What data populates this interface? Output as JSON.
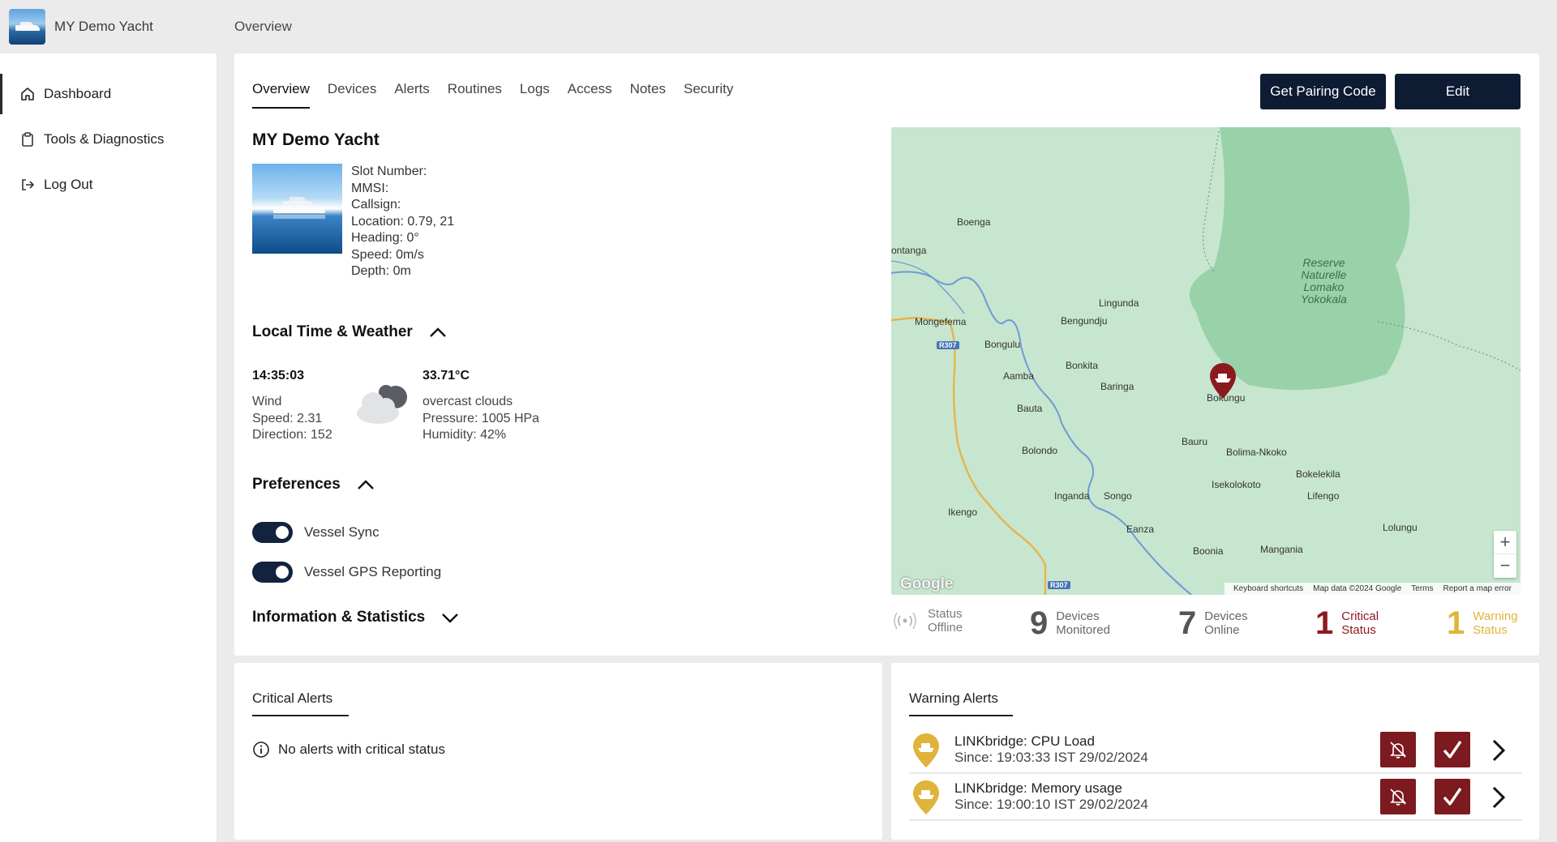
{
  "app": {
    "title": "MY Demo Yacht",
    "breadcrumb": "Overview"
  },
  "sidebar": {
    "items": [
      {
        "label": "Dashboard",
        "icon": "home-icon",
        "active": true
      },
      {
        "label": "Tools & Diagnostics",
        "icon": "clipboard-icon"
      },
      {
        "label": "Log Out",
        "icon": "logout-icon"
      }
    ]
  },
  "tabs": [
    "Overview",
    "Devices",
    "Alerts",
    "Routines",
    "Logs",
    "Access",
    "Notes",
    "Security"
  ],
  "buttons": {
    "pairing": "Get Pairing Code",
    "edit": "Edit"
  },
  "vessel": {
    "name": "MY Demo Yacht",
    "details": [
      "Slot Number:",
      "MMSI:",
      "Callsign:",
      "Location: 0.79, 21",
      "Heading: 0°",
      "Speed: 0m/s",
      "Depth: 0m"
    ]
  },
  "weather": {
    "section_title": "Local Time & Weather",
    "time": "14:35:03",
    "wind_label": "Wind",
    "wind_speed": "Speed: 2.31",
    "wind_direction": "Direction: 152",
    "temperature": "33.71°C",
    "description": "overcast clouds",
    "pressure": "Pressure: 1005 HPa",
    "humidity": "Humidity: 42%"
  },
  "preferences": {
    "section_title": "Preferences",
    "toggles": [
      {
        "label": "Vessel Sync",
        "on": true
      },
      {
        "label": "Vessel GPS Reporting",
        "on": true
      }
    ]
  },
  "info_section": {
    "title": "Information & Statistics"
  },
  "map": {
    "labels": [
      "Boenga",
      "ontanga",
      "Lingunda",
      "Bengundju",
      "Mongefema",
      "Bongulu",
      "Bonkita",
      "Aamba",
      "Baringa",
      "Bauta",
      "Bokungu",
      "Bauru",
      "Bolima-Nkoko",
      "Bolondo",
      "Bokelekila",
      "Isekolokoto",
      "Lifengo",
      "Inganda",
      "Songo",
      "Ikengo",
      "Eanza",
      "Lolungu",
      "Boonia",
      "Mangania"
    ],
    "reserve_label": [
      "Reserve",
      "Naturelle",
      "Lomako",
      "Yokokala"
    ],
    "road_labels": [
      "R307",
      "R307"
    ],
    "google": "Google",
    "footer": [
      "Keyboard shortcuts",
      "Map data ©2024 Google",
      "Terms",
      "Report a map error"
    ],
    "zoom_in": "+",
    "zoom_out": "−"
  },
  "stats": [
    {
      "value": "",
      "lbl1": "Status",
      "lbl2": "Offline",
      "color": "#9a9a9a"
    },
    {
      "value": "9",
      "lbl1": "Devices",
      "lbl2": "Monitored",
      "color": "#555555"
    },
    {
      "value": "7",
      "lbl1": "Devices",
      "lbl2": "Online",
      "color": "#555555"
    },
    {
      "value": "1",
      "lbl1": "Critical",
      "lbl2": "Status",
      "color": "#8b1a1f"
    },
    {
      "value": "1",
      "lbl1": "Warning",
      "lbl2": "Status",
      "color": "#e0b43a"
    }
  ],
  "critical_alerts": {
    "title": "Critical Alerts",
    "empty": "No alerts with critical status"
  },
  "warning_alerts": {
    "title": "Warning Alerts",
    "items": [
      {
        "title": "LINKbridge: CPU Load",
        "since": "Since: 19:03:33 IST 29/02/2024"
      },
      {
        "title": "LINKbridge: Memory usage",
        "since": "Since: 19:00:10 IST 29/02/2024"
      }
    ]
  },
  "colors": {
    "navy": "#0d1b33",
    "critical": "#7c1a1f",
    "warning": "#e0b43a"
  }
}
